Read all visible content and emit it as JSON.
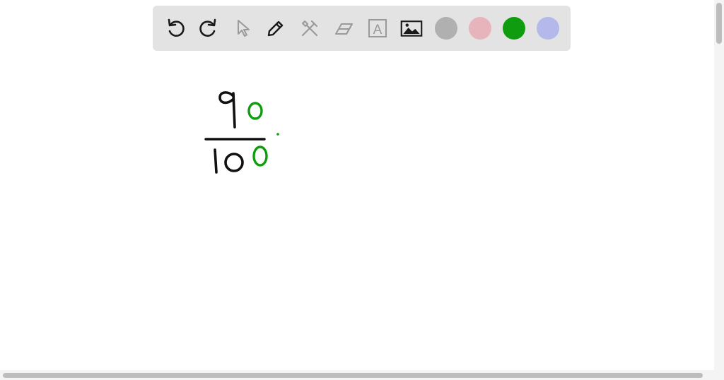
{
  "toolbar": {
    "tools": [
      {
        "name": "undo-icon",
        "state": "enabled"
      },
      {
        "name": "redo-icon",
        "state": "enabled"
      },
      {
        "name": "select-pointer-icon",
        "state": "disabled"
      },
      {
        "name": "pen-icon",
        "state": "active"
      },
      {
        "name": "tools-icon",
        "state": "disabled"
      },
      {
        "name": "eraser-icon",
        "state": "disabled"
      },
      {
        "name": "text-icon",
        "state": "disabled",
        "glyph": "A"
      },
      {
        "name": "image-icon",
        "state": "enabled"
      }
    ],
    "colors": [
      "#b0b0b0",
      "#e8b4bc",
      "#0f9d0f",
      "#b4b8ea"
    ],
    "selected_color": "#0f9d0f"
  },
  "canvas": {
    "background": "#ffffff",
    "ink_colors": {
      "black": "#111111",
      "green": "#0f9d0f"
    },
    "handwriting": {
      "numerator": [
        "9",
        "0"
      ],
      "denominator": [
        "1",
        "0",
        "0"
      ]
    }
  }
}
